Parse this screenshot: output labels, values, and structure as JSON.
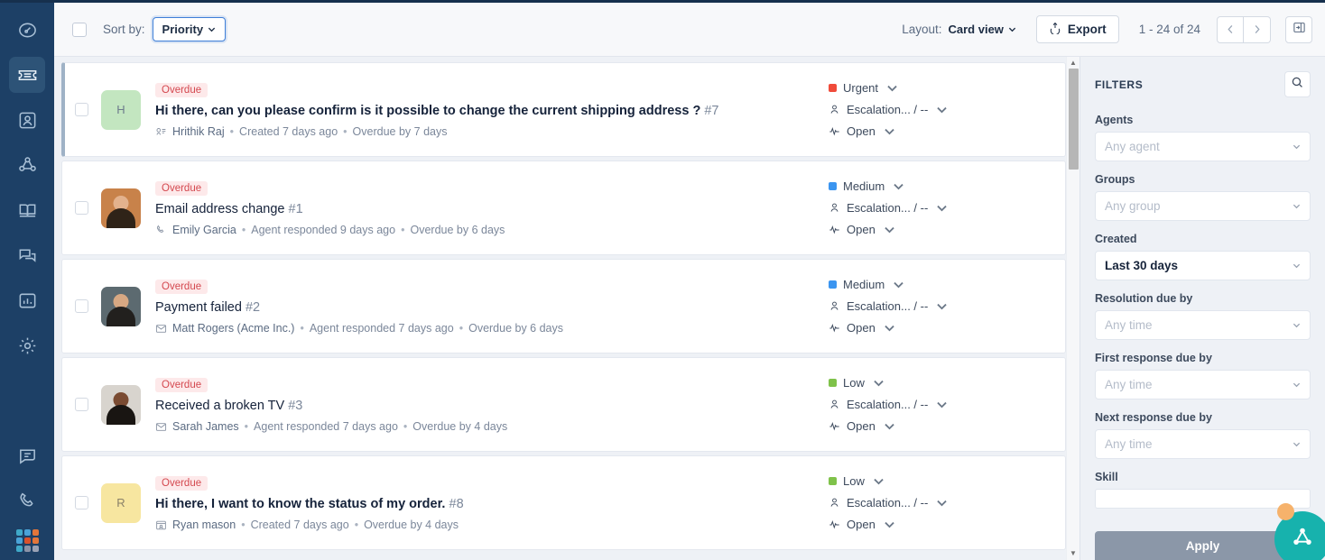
{
  "sidebar": {
    "items": [
      {
        "name": "dashboard-icon",
        "label": "Dashboard",
        "active": false
      },
      {
        "name": "tickets-icon",
        "label": "Tickets",
        "active": true
      },
      {
        "name": "contacts-icon",
        "label": "Contacts",
        "active": false
      },
      {
        "name": "network-icon",
        "label": "Social",
        "active": false
      },
      {
        "name": "knowledgebase-icon",
        "label": "Knowledge base",
        "active": false
      },
      {
        "name": "chat-windows-icon",
        "label": "Chat",
        "active": false
      },
      {
        "name": "reports-icon",
        "label": "Analytics",
        "active": false
      },
      {
        "name": "settings-gear-icon",
        "label": "Admin",
        "active": false
      }
    ],
    "bottom_items": [
      {
        "name": "message-bubble-icon",
        "label": "Messaging"
      },
      {
        "name": "phone-icon",
        "label": "Phone"
      }
    ],
    "app_switcher": {
      "name": "app-switcher-grid-icon",
      "label": "Switch product",
      "colors": [
        "#3fa9c9",
        "#4aa3d8",
        "#e2763a",
        "#4aa3d8",
        "#d9512c",
        "#e2763a",
        "#3fa9c9",
        "#8b93a8",
        "#9aa2b5"
      ]
    }
  },
  "toolbar": {
    "select_all_label": "Select all",
    "sort_by_label": "Sort by:",
    "sort_value": "Priority",
    "layout_label": "Layout:",
    "layout_value": "Card view",
    "export_label": "Export",
    "pagination": "1 - 24 of 24",
    "prev_label": "‹",
    "next_label": "›",
    "panel_toggle_label": "Toggle panel"
  },
  "tickets": [
    {
      "selected": true,
      "badge": "Overdue",
      "title": "Hi there, can you please confirm is it possible to change the current shipping address ?",
      "number": "#7",
      "bold": true,
      "requester": "Hrithik Raj",
      "activity": "Created 7 days ago",
      "overdue": "Overdue by 7 days",
      "channel_icon": "feedback-widget-icon",
      "avatar": {
        "type": "initial",
        "initial": "H",
        "bg": "#c3e6c0",
        "fg": "#6d7b8c"
      },
      "priority": {
        "label": "Urgent",
        "color": "#f04b3a"
      },
      "assignee": "Escalation... / --",
      "status": "Open"
    },
    {
      "selected": false,
      "badge": "Overdue",
      "title": "Email address change",
      "number": "#1",
      "bold": false,
      "requester": "Emily Garcia",
      "activity": "Agent responded 9 days ago",
      "overdue": "Overdue by 6 days",
      "channel_icon": "phone-icon",
      "avatar": {
        "type": "photo",
        "skin": "#e3b28d",
        "hair": "#2f2318",
        "bg": "#c8824a"
      },
      "priority": {
        "label": "Medium",
        "color": "#3b95f0"
      },
      "assignee": "Escalation... / --",
      "status": "Open"
    },
    {
      "selected": false,
      "badge": "Overdue",
      "title": "Payment failed",
      "number": "#2",
      "bold": false,
      "requester": "Matt Rogers (Acme Inc.)",
      "activity": "Agent responded 7 days ago",
      "overdue": "Overdue by 6 days",
      "channel_icon": "email-icon",
      "avatar": {
        "type": "photo",
        "skin": "#d7a883",
        "hair": "#22201e",
        "bg": "#5c6a70"
      },
      "priority": {
        "label": "Medium",
        "color": "#3b95f0"
      },
      "assignee": "Escalation... / --",
      "status": "Open"
    },
    {
      "selected": false,
      "badge": "Overdue",
      "title": "Received a broken TV",
      "number": "#3",
      "bold": false,
      "requester": "Sarah James",
      "activity": "Agent responded 7 days ago",
      "overdue": "Overdue by 4 days",
      "channel_icon": "email-icon",
      "avatar": {
        "type": "photo",
        "skin": "#7a4b32",
        "hair": "#191512",
        "bg": "#d8d4ce"
      },
      "priority": {
        "label": "Low",
        "color": "#7fc24a"
      },
      "assignee": "Escalation... / --",
      "status": "Open"
    },
    {
      "selected": false,
      "badge": "Overdue",
      "title": "Hi there, I want to know the status of my order.",
      "number": "#8",
      "bold": true,
      "requester": "Ryan mason",
      "activity": "Created 7 days ago",
      "overdue": "Overdue by 4 days",
      "channel_icon": "portal-icon",
      "avatar": {
        "type": "initial",
        "initial": "R",
        "bg": "#f7e6a0",
        "fg": "#8a8168"
      },
      "priority": {
        "label": "Low",
        "color": "#7fc24a"
      },
      "assignee": "Escalation... / --",
      "status": "Open"
    }
  ],
  "filters": {
    "title": "FILTERS",
    "search_label": "Search filters",
    "groups": [
      {
        "label": "Agents",
        "value": "Any agent",
        "filled": false,
        "type": "select"
      },
      {
        "label": "Groups",
        "value": "Any group",
        "filled": false,
        "type": "select"
      },
      {
        "label": "Created",
        "value": "Last 30 days",
        "filled": true,
        "type": "select"
      },
      {
        "label": "Resolution due by",
        "value": "Any time",
        "filled": false,
        "type": "select"
      },
      {
        "label": "First response due by",
        "value": "Any time",
        "filled": false,
        "type": "select"
      },
      {
        "label": "Next response due by",
        "value": "Any time",
        "filled": false,
        "type": "select"
      },
      {
        "label": "Skill",
        "value": "",
        "filled": false,
        "type": "input"
      }
    ],
    "apply_label": "Apply"
  },
  "fab": {
    "name": "support-bot-fab",
    "label": "Help"
  },
  "colors": {
    "nav_bg": "#1d4066",
    "accent_blue": "#3f7fd8",
    "badge_bg": "#fde9ea",
    "badge_fg": "#d4484f",
    "fab_teal": "#17b2ad",
    "cursor": "#f6b26b"
  }
}
